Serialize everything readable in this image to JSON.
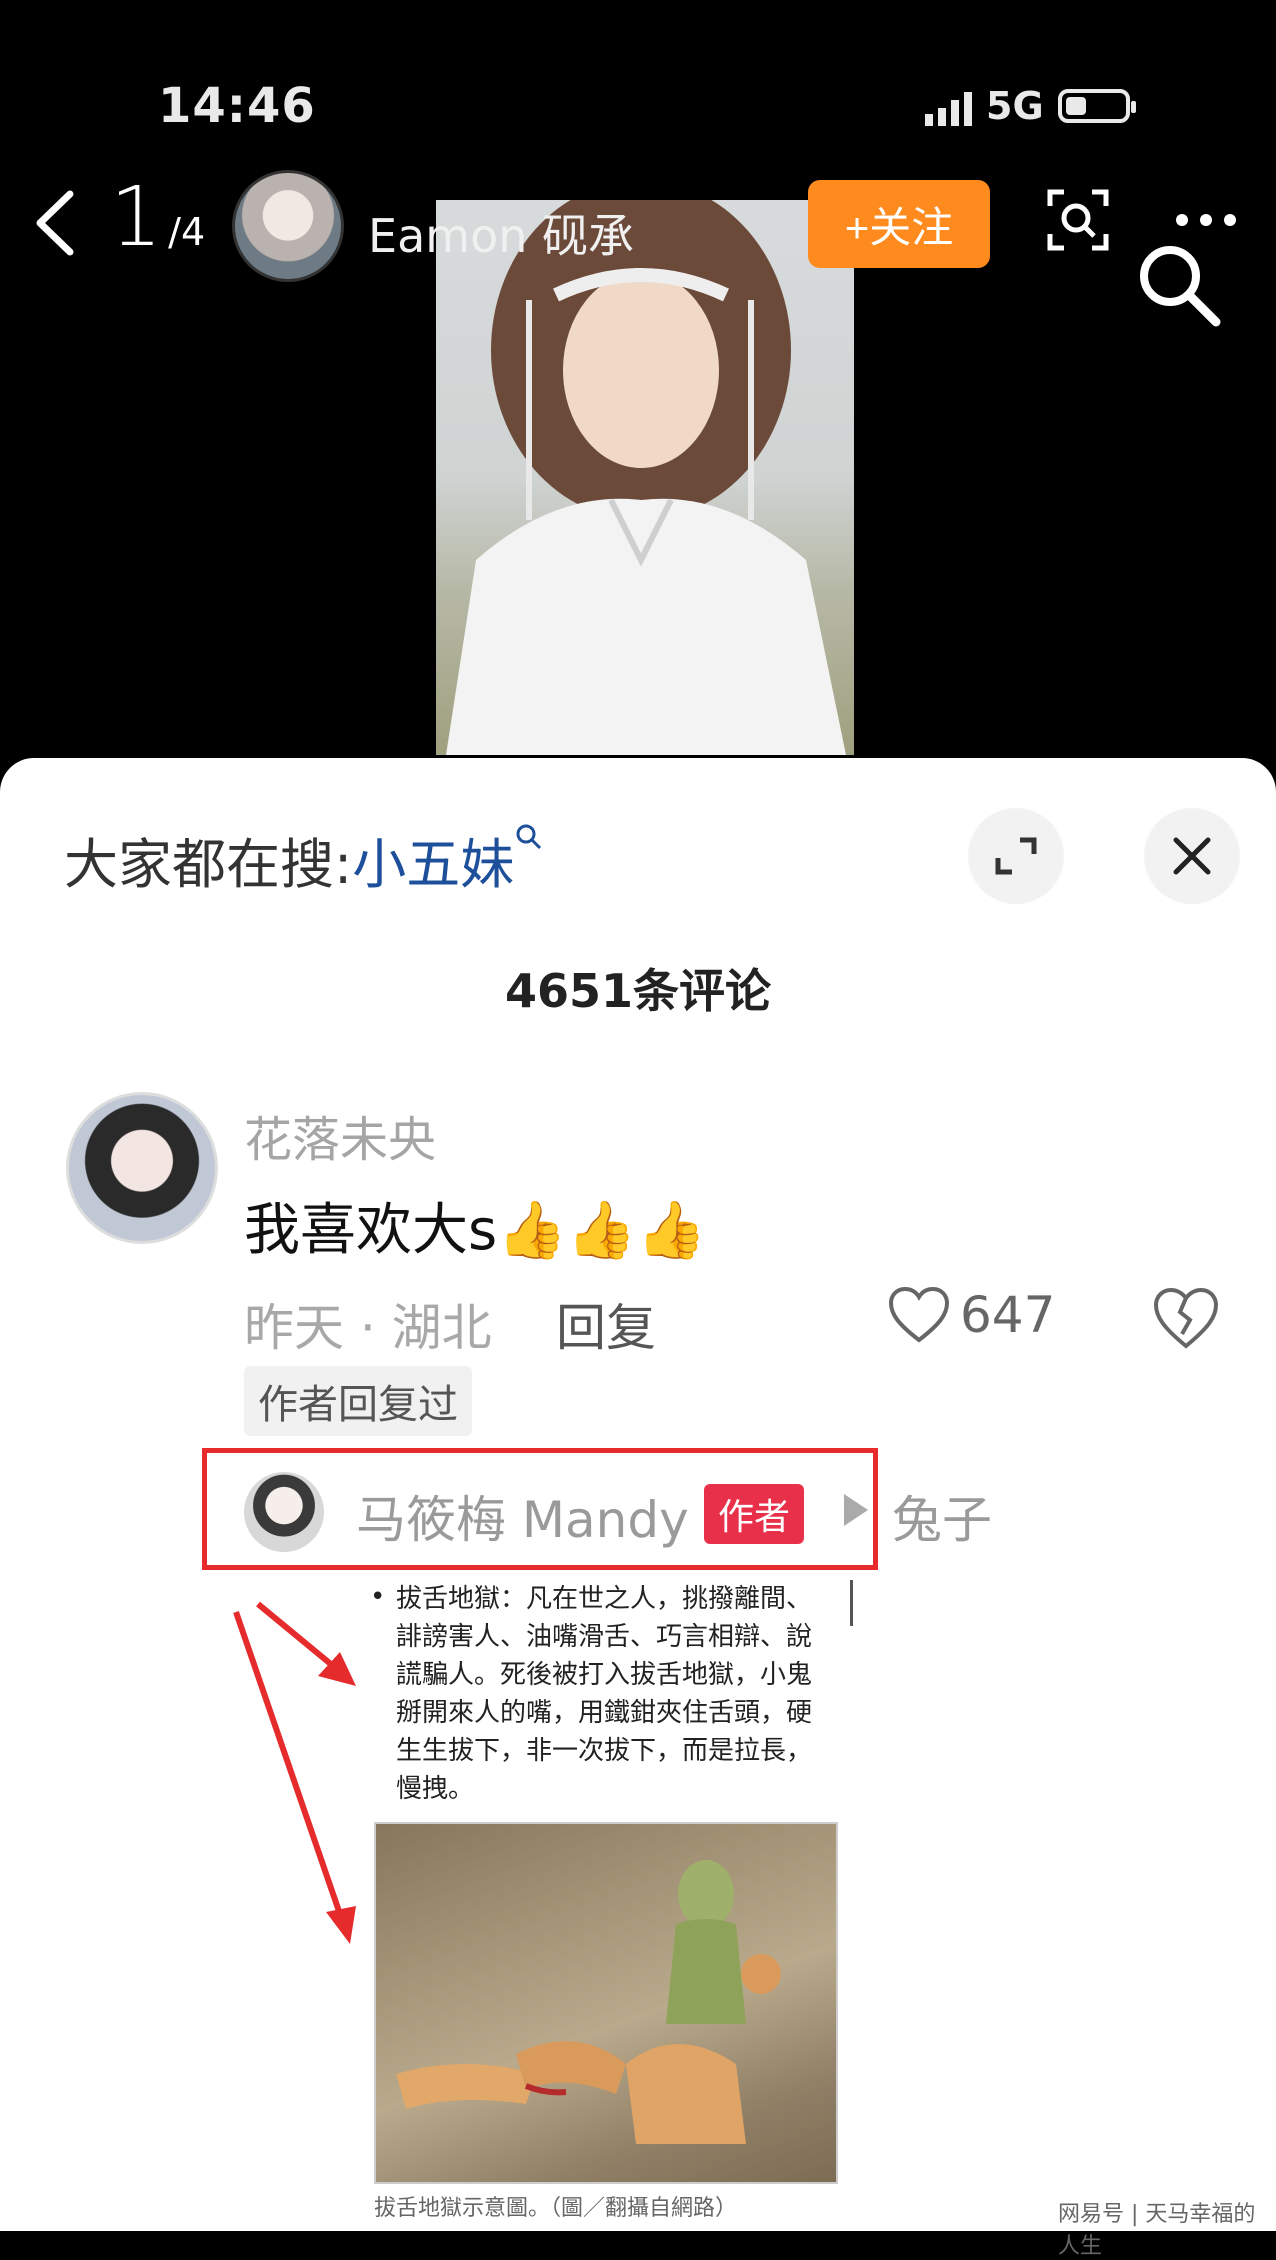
{
  "status_bar": {
    "time": "14:46",
    "network": "5G"
  },
  "nav": {
    "page_current": "1",
    "page_total": "/4",
    "author_name": "Eamon 砚承",
    "follow_label": "+关注"
  },
  "panel": {
    "search_prefix": "大家都在搜:",
    "search_keyword": "小五妹",
    "comment_count": "4651条评论"
  },
  "comment": {
    "username": "花落未央",
    "text": "我喜欢大s👍👍👍",
    "meta": "昨天 · 湖北",
    "reply_label": "回复",
    "likes": "647",
    "author_replied_tag": "作者回复过"
  },
  "reply": {
    "name": "马筱梅 Mandy",
    "badge": "作者",
    "target": "兔子"
  },
  "doc": {
    "bullet": "•",
    "text": "拔舌地獄：凡在世之人，挑撥離間、誹謗害人、油嘴滑舌、巧言相辯、說謊騙人。死後被打入拔舌地獄，小鬼掰開來人的嘴，用鐵鉗夾住舌頭，硬生生拔下，非一次拔下，而是拉長，慢拽。",
    "caption": "拔舌地獄示意圖。（圖／翻攝自網路）"
  },
  "watermark": "网易号 | 天马幸福的人生",
  "colors": {
    "follow": "#ff8a1d",
    "badge": "#e8304a",
    "highlight_box": "#e52b2b",
    "search_keyword": "#1d4f9a"
  }
}
